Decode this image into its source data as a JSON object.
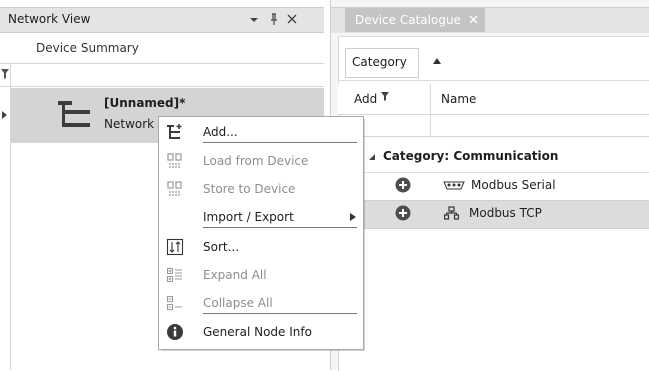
{
  "network_view": {
    "title": "Network View",
    "column_header": "Device Summary",
    "node": {
      "name": "[Unnamed]*",
      "subtitle": "Network"
    }
  },
  "device_catalogue": {
    "tab_label": "Device Catalogue",
    "group_button": "Category",
    "columns": {
      "add": "Add",
      "name": "Name"
    },
    "group_label": "Category: Communication",
    "items": [
      {
        "name": "Modbus Serial",
        "icon": "serial-port-icon",
        "selected": false
      },
      {
        "name": "Modbus TCP",
        "icon": "network-icon",
        "selected": true
      }
    ]
  },
  "context_menu": {
    "items": [
      {
        "label": "Add...",
        "icon": "add-node-icon",
        "enabled": true
      },
      {
        "label": "Load from Device",
        "icon": "load-device-icon",
        "enabled": false
      },
      {
        "label": "Store to Device",
        "icon": "store-device-icon",
        "enabled": false
      },
      {
        "label": "Import / Export",
        "icon": "",
        "enabled": true,
        "submenu": true
      },
      {
        "label": "Sort...",
        "icon": "sort-icon",
        "enabled": true
      },
      {
        "label": "Expand All",
        "icon": "expand-all-icon",
        "enabled": false
      },
      {
        "label": "Collapse All",
        "icon": "collapse-all-icon",
        "enabled": false
      },
      {
        "label": "General Node Info",
        "icon": "info-icon",
        "enabled": true
      }
    ]
  },
  "colors": {
    "title_bar": "#e4e4e4",
    "selected_row": "#d4d4d4",
    "tab_active": "#c4c4c4",
    "disabled_text": "#8e8e8e",
    "add_button": "#4d4d4d"
  }
}
